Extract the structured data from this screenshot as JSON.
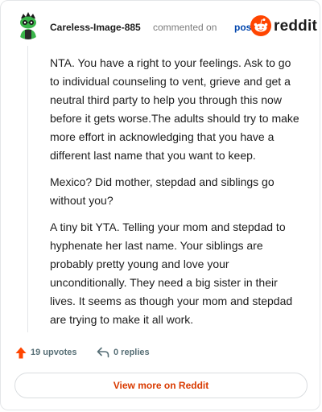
{
  "header": {
    "username": "Careless-Image-885",
    "action_text": "commented on",
    "post_link": "post",
    "brand": "reddit"
  },
  "comment": {
    "paragraphs": [
      "NTA. You have a right to your feelings. Ask to go to individual counseling to vent, grieve and get a neutral third party to help you through this now before it gets worse.The adults should try to make more effort in acknowledging that you have a different last name that you want to keep.",
      "Mexico? Did mother, stepdad and siblings go without you?",
      "A tiny bit YTA. Telling your mom and stepdad to hyphenate her last name. Your siblings are probably pretty young and love your unconditionally. They need a big sister in their lives. It seems as though your mom and stepdad are trying to make it all work."
    ]
  },
  "footer": {
    "upvotes_label": "19 upvotes",
    "replies_label": "0 replies"
  },
  "cta": {
    "label": "View more on Reddit"
  },
  "colors": {
    "brand_orange": "#ff4500",
    "link_blue": "#0045ac",
    "cta_text": "#d93a00",
    "avatar_green": "#3ab54a"
  },
  "icons": {
    "avatar": "snoo-avatar-icon",
    "logo": "reddit-logo-icon",
    "upvote": "upvote-arrow-icon",
    "reply": "reply-arrow-icon"
  }
}
